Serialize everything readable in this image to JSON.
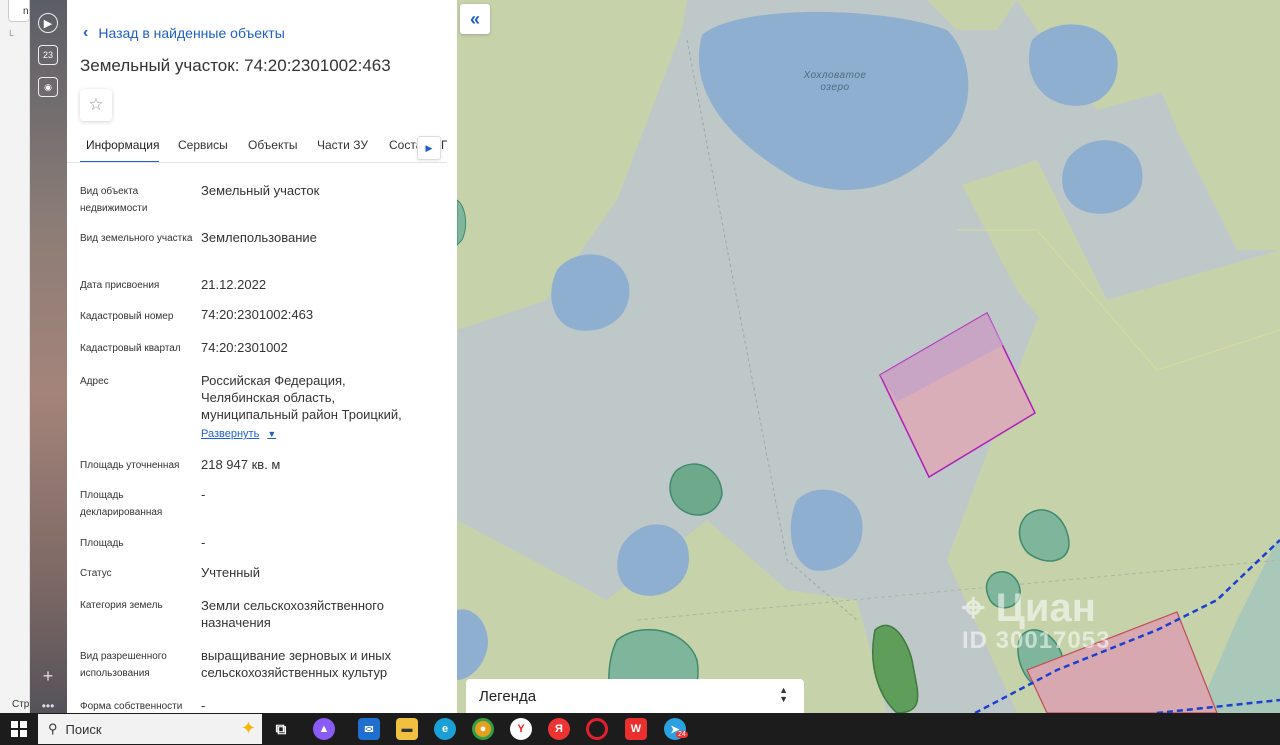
{
  "browser": {
    "tab_fragment": "n",
    "status_fragment": "Стр"
  },
  "sidebar": {
    "icons": [
      "play-icon",
      "calendar-icon",
      "camera-icon",
      "plus-icon",
      "more-icon"
    ],
    "calendar_day": "23"
  },
  "panel": {
    "back_label": "Назад в найденные объекты",
    "title": "Земельный участок: 74:20:2301002:463",
    "tabs": [
      "Информация",
      "Сервисы",
      "Объекты",
      "Части ЗУ",
      "Соста",
      "П"
    ],
    "rows": [
      {
        "label": "Вид объекта недвижимости",
        "value": "Земельный участок"
      },
      {
        "label": "Вид земельного участка",
        "value": "Землепользование"
      },
      {
        "label": "Дата присвоения",
        "value": "21.12.2022"
      },
      {
        "label": "Кадастровый номер",
        "value": "74:20:2301002:463"
      },
      {
        "label": "Кадастровый квартал",
        "value": "74:20:2301002"
      },
      {
        "label": "Адрес",
        "value": "Российская Федерация, Челябинская область, муниципальный район Троицкий,"
      },
      {
        "label": "Площадь уточненная",
        "value": "218 947 кв. м"
      },
      {
        "label": "Площадь декларированная",
        "value": "-"
      },
      {
        "label": "Площадь",
        "value": "-"
      },
      {
        "label": "Статус",
        "value": "Учтенный"
      },
      {
        "label": "Категория земель",
        "value": "Земли сельскохозяйственного назначения"
      },
      {
        "label": "Вид разрешенного использования",
        "value": "выращивание зерновых и иных сельскохозяйственных культур"
      },
      {
        "label": "Форма собственности",
        "value": "-"
      }
    ],
    "expand_label": "Развернуть"
  },
  "map": {
    "lake_label": "Хохловатое озеро",
    "legend_label": "Легенда",
    "watermark_id": "ID 30017053",
    "colors": {
      "base": "#bfc8c9",
      "field": "#c6d2aa",
      "water": "#8eafd0",
      "parcel_fill": "#d9aeb9",
      "parcel_stroke": "#b020b8",
      "wetland": "#6fa98c"
    }
  },
  "taskbar": {
    "search_label": "Поиск",
    "apps": [
      "task-view-icon",
      "alice-icon",
      "mail-icon",
      "explorer-icon",
      "edge-icon",
      "chrome-icon",
      "yandex-browser-icon",
      "yandex-icon",
      "opera-icon",
      "wps-icon",
      "telegram-icon"
    ],
    "telegram_badge": "24"
  }
}
